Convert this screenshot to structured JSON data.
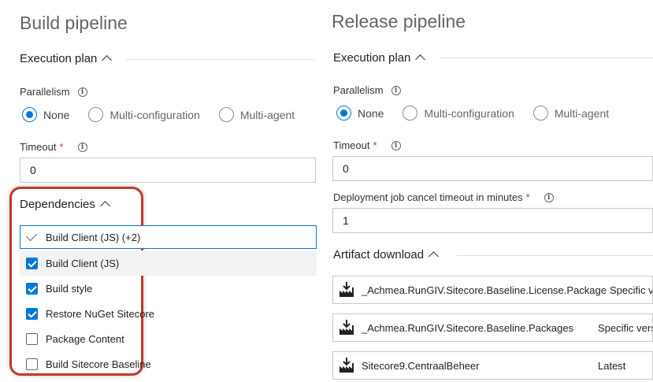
{
  "build": {
    "title": "Build pipeline",
    "execution_plan": "Execution plan",
    "parallelism_label": "Parallelism",
    "radio_options": [
      "None",
      "Multi-configuration",
      "Multi-agent"
    ],
    "timeout_label": "Timeout",
    "required_mark": "*",
    "timeout_value": "0",
    "dependencies_label": "Dependencies",
    "dependencies_selected": "Build Client (JS) (+2)",
    "dependency_items": [
      {
        "label": "Build Client (JS)",
        "checked": true
      },
      {
        "label": "Build style",
        "checked": true
      },
      {
        "label": "Restore NuGet Sitecore",
        "checked": true
      },
      {
        "label": "Package Content",
        "checked": false
      },
      {
        "label": "Build Sitecore Baseline",
        "checked": false
      }
    ]
  },
  "release": {
    "title": "Release pipeline",
    "execution_plan": "Execution plan",
    "parallelism_label": "Parallelism",
    "radio_options": [
      "None",
      "Multi-configuration",
      "Multi-agent"
    ],
    "timeout_label": "Timeout",
    "required_mark": "*",
    "timeout_value": "0",
    "cancel_timeout_label": "Deployment job cancel timeout in minutes",
    "cancel_timeout_value": "1",
    "artifact_download_label": "Artifact download",
    "artifacts": [
      {
        "name": "_Achmea.RunGIV.Sitecore.Baseline.License.Package",
        "version": "Specific v"
      },
      {
        "name": "_Achmea.RunGIV.Sitecore.Baseline.Packages",
        "version": "Specific vers"
      },
      {
        "name": "Sitecore9.CentraalBeheer",
        "version": "Latest"
      }
    ]
  },
  "colors": {
    "accent": "#0078d4",
    "highlight": "#c0392b",
    "required": "#c4314b"
  },
  "icons": {
    "info": "info-icon",
    "artifact": "build-artifact-icon",
    "collapse": "chevron-up-icon"
  }
}
